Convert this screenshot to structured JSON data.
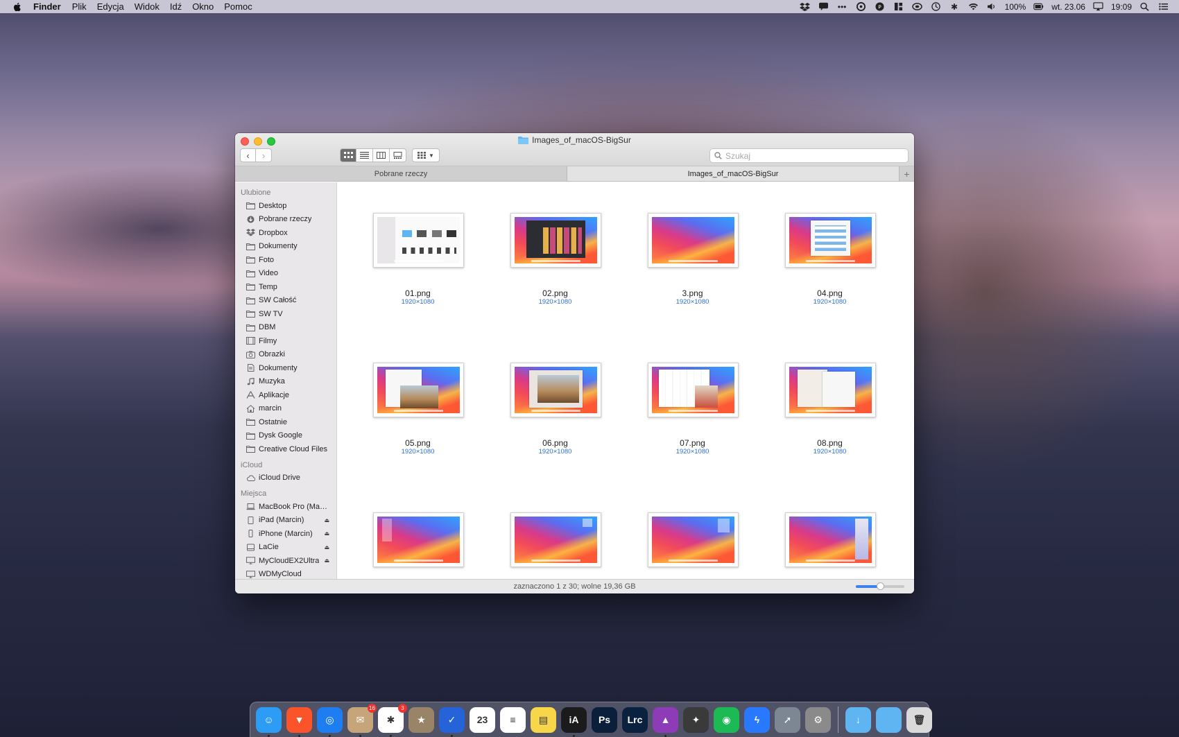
{
  "menubar": {
    "app_name": "Finder",
    "items": [
      "Plik",
      "Edycja",
      "Widok",
      "Idź",
      "Okno",
      "Pomoc"
    ],
    "battery": "100%",
    "date": "wt. 23.06",
    "time": "19:09"
  },
  "window": {
    "title": "Images_of_macOS-BigSur",
    "search_placeholder": "Szukaj",
    "tabs": [
      "Pobrane rzeczy",
      "Images_of_macOS-BigSur"
    ],
    "tab_add": "+",
    "status": "zaznaczono 1 z 30; wolne 19,36 GB",
    "zoom_level": 0.5
  },
  "sidebar": {
    "favorites_header": "Ulubione",
    "favorites": [
      {
        "label": "Desktop",
        "icon": "folder"
      },
      {
        "label": "Pobrane rzeczy",
        "icon": "download"
      },
      {
        "label": "Dropbox",
        "icon": "dropbox"
      },
      {
        "label": "Dokumenty",
        "icon": "folder"
      },
      {
        "label": "Foto",
        "icon": "folder"
      },
      {
        "label": "Video",
        "icon": "folder"
      },
      {
        "label": "Temp",
        "icon": "folder"
      },
      {
        "label": "SW Całość",
        "icon": "folder"
      },
      {
        "label": "SW TV",
        "icon": "folder"
      },
      {
        "label": "DBM",
        "icon": "folder"
      },
      {
        "label": "Filmy",
        "icon": "film"
      },
      {
        "label": "Obrazki",
        "icon": "camera"
      },
      {
        "label": "Dokumenty",
        "icon": "document"
      },
      {
        "label": "Muzyka",
        "icon": "music"
      },
      {
        "label": "Aplikacje",
        "icon": "apps"
      },
      {
        "label": "marcin",
        "icon": "home"
      },
      {
        "label": "Ostatnie",
        "icon": "folder"
      },
      {
        "label": "Dysk Google",
        "icon": "folder"
      },
      {
        "label": "Creative Cloud Files",
        "icon": "folder"
      }
    ],
    "icloud_header": "iCloud",
    "icloud": [
      {
        "label": "iCloud Drive",
        "icon": "cloud"
      }
    ],
    "places_header": "Miejsca",
    "places": [
      {
        "label": "MacBook Pro (Marci...",
        "icon": "laptop",
        "eject": false
      },
      {
        "label": "iPad (Marcin)",
        "icon": "tablet",
        "eject": true
      },
      {
        "label": "iPhone (Marcin)",
        "icon": "phone",
        "eject": true
      },
      {
        "label": "LaCie",
        "icon": "disk",
        "eject": true
      },
      {
        "label": "MyCloudEX2Ultra",
        "icon": "display",
        "eject": true
      },
      {
        "label": "WDMyCloud",
        "icon": "display",
        "eject": false
      }
    ]
  },
  "files": [
    {
      "name": "01.png",
      "dims": "1920×1080",
      "preview": "finder-window"
    },
    {
      "name": "02.png",
      "dims": "1920×1080",
      "preview": "music-dark"
    },
    {
      "name": "3.png",
      "dims": "1920×1080",
      "preview": "wallpaper"
    },
    {
      "name": "04.png",
      "dims": "1920×1080",
      "preview": "app-window"
    },
    {
      "name": "05.png",
      "dims": "1920×1080",
      "preview": "photo-window"
    },
    {
      "name": "06.png",
      "dims": "1920×1080",
      "preview": "photo-large"
    },
    {
      "name": "07.png",
      "dims": "1920×1080",
      "preview": "calendar-window"
    },
    {
      "name": "08.png",
      "dims": "1920×1080",
      "preview": "book-window"
    },
    {
      "name": "",
      "dims": "",
      "preview": "panel-left"
    },
    {
      "name": "",
      "dims": "",
      "preview": "panel-right"
    },
    {
      "name": "",
      "dims": "",
      "preview": "notification"
    },
    {
      "name": "",
      "dims": "",
      "preview": "control-center"
    }
  ],
  "dock": {
    "apps": [
      {
        "name": "finder",
        "color": "#2d9cf5",
        "glyph": "☺",
        "badge": "",
        "running": true
      },
      {
        "name": "brave",
        "color": "#fb542b",
        "glyph": "▼",
        "badge": "",
        "running": true
      },
      {
        "name": "safari",
        "color": "#1e7df0",
        "glyph": "◎",
        "badge": "",
        "running": true
      },
      {
        "name": "mail",
        "color": "#c7a57a",
        "glyph": "✉",
        "badge": "16",
        "running": true
      },
      {
        "name": "slack",
        "color": "#ffffff",
        "glyph": "✱",
        "badge": "3",
        "running": true
      },
      {
        "name": "archive",
        "color": "#9a8467",
        "glyph": "★",
        "badge": "",
        "running": false
      },
      {
        "name": "tasks",
        "color": "#2563d9",
        "glyph": "✓",
        "badge": "",
        "running": true
      },
      {
        "name": "calendar",
        "color": "#ffffff",
        "glyph": "23",
        "badge": "",
        "running": false
      },
      {
        "name": "reminders",
        "color": "#ffffff",
        "glyph": "≡",
        "badge": "",
        "running": false
      },
      {
        "name": "notes",
        "color": "#f7d64a",
        "glyph": "▤",
        "badge": "",
        "running": false
      },
      {
        "name": "ia-writer",
        "color": "#1b1b1b",
        "glyph": "iA",
        "badge": "",
        "running": true
      },
      {
        "name": "photoshop",
        "color": "#0b1f3a",
        "glyph": "Ps",
        "badge": "",
        "running": false
      },
      {
        "name": "lightroom",
        "color": "#0a2240",
        "glyph": "Lrc",
        "badge": "",
        "running": false
      },
      {
        "name": "affinity",
        "color": "#8e3bb8",
        "glyph": "▲",
        "badge": "",
        "running": true
      },
      {
        "name": "final-cut",
        "color": "#3a3a3a",
        "glyph": "✦",
        "badge": "",
        "running": false
      },
      {
        "name": "spotify",
        "color": "#1db954",
        "glyph": "◉",
        "badge": "",
        "running": false
      },
      {
        "name": "messenger",
        "color": "#2979ff",
        "glyph": "ϟ",
        "badge": "",
        "running": false
      },
      {
        "name": "launchpad",
        "color": "#7d8794",
        "glyph": "➚",
        "badge": "",
        "running": false
      },
      {
        "name": "system-preferences",
        "color": "#8a8a8a",
        "glyph": "⚙",
        "badge": "",
        "running": false
      }
    ],
    "folders": [
      {
        "name": "downloads-folder",
        "color": "#5fb4f2",
        "glyph": "↓"
      },
      {
        "name": "documents-folder",
        "color": "#5fb4f2",
        "glyph": ""
      },
      {
        "name": "trash",
        "color": "#dadada",
        "glyph": "🗑"
      }
    ]
  }
}
